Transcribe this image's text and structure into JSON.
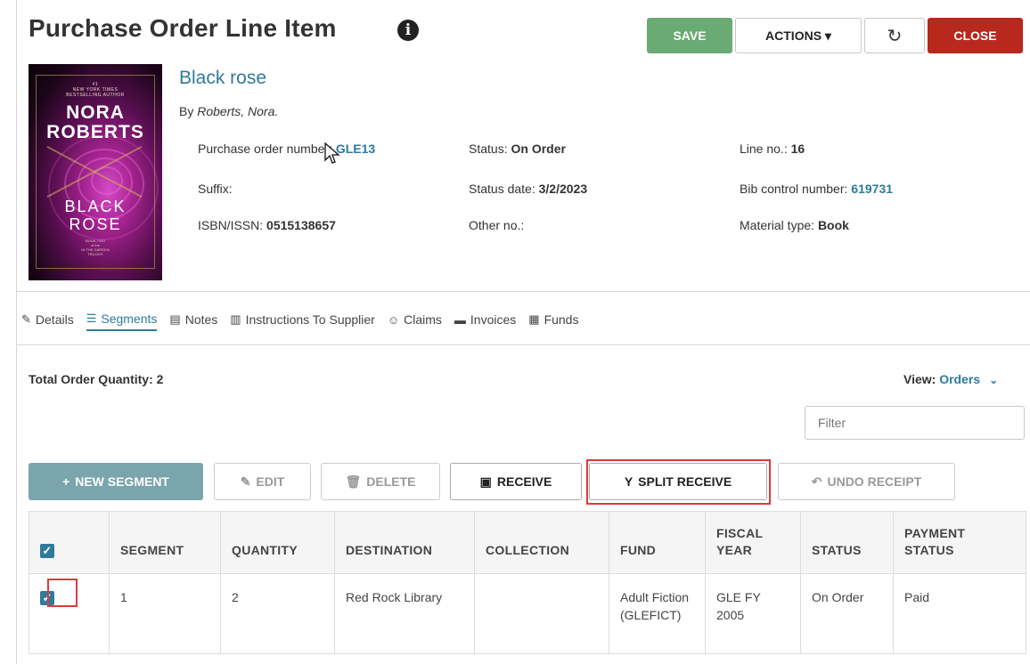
{
  "header": {
    "title": "Purchase Order Line Item",
    "info_icon": "info-circle-icon",
    "save_label": "SAVE",
    "actions_label": "ACTIONS",
    "actions_caret": "▾",
    "refresh_icon": "refresh-icon",
    "close_label": "CLOSE",
    "save_color": "#6aaa73",
    "close_color": "#b8281d"
  },
  "cover": {
    "nyt_line1": "#1",
    "nyt_line2": "NEW YORK TIMES",
    "nyt_line3": "BESTSELLING AUTHOR",
    "author_line1": "NORA",
    "author_line2": "ROBERTS",
    "title_line1": "BLACK",
    "title_line2": "ROSE",
    "series_line1": "BOOK TWO",
    "series_line2": "of the",
    "series_line3": "IN THE GARDEN",
    "series_line4": "TRILOGY"
  },
  "item": {
    "title": "Black rose",
    "by_label": "By",
    "author": "Roberts, Nora.",
    "po_label": "Purchase order number:",
    "po_value": "GLE13",
    "status_label": "Status:",
    "status_value": "On Order",
    "line_label": "Line no.:",
    "line_value": "16",
    "suffix_label": "Suffix:",
    "status_date_label": "Status date:",
    "status_date_value": "3/2/2023",
    "bib_label": "Bib control number:",
    "bib_value": "619731",
    "isbn_label": "ISBN/ISSN:",
    "isbn_value": "0515138657",
    "other_label": "Other no.:",
    "material_label": "Material type:",
    "material_value": "Book"
  },
  "tabs": [
    {
      "label": "Details",
      "icon": "edit-icon",
      "glyph": "✎"
    },
    {
      "label": "Segments",
      "icon": "list-icon",
      "glyph": "☰"
    },
    {
      "label": "Notes",
      "icon": "notes-icon",
      "glyph": "▤"
    },
    {
      "label": "Instructions To Supplier",
      "icon": "building-icon",
      "glyph": "▥"
    },
    {
      "label": "Claims",
      "icon": "smile-icon",
      "glyph": "☺"
    },
    {
      "label": "Invoices",
      "icon": "money-icon",
      "glyph": "▬"
    },
    {
      "label": "Funds",
      "icon": "bank-icon",
      "glyph": "▦"
    }
  ],
  "segments": {
    "total_label": "Total Order Quantity: 2",
    "view_label": "View:",
    "view_value": "Orders",
    "filter_placeholder": "Filter",
    "buttons": {
      "new": "NEW SEGMENT",
      "edit": "EDIT",
      "delete": "DELETE",
      "receive": "RECEIVE",
      "split": "SPLIT RECEIVE",
      "undo": "UNDO RECEIPT"
    },
    "columns": [
      "SEGMENT",
      "QUANTITY",
      "DESTINATION",
      "COLLECTION",
      "FUND",
      "FISCAL YEAR",
      "STATUS",
      "PAYMENT STATUS"
    ],
    "rows": [
      {
        "segment": "1",
        "quantity": "2",
        "destination": "Red Rock Library",
        "collection": "",
        "fund": "Adult Fiction (GLEFICT)",
        "fiscal_year": "GLE FY 2005",
        "status": "On Order",
        "payment_status": "Paid",
        "checked": true
      }
    ],
    "accent_color": "#2f7a9a",
    "highlight_color": "#e0393b"
  }
}
